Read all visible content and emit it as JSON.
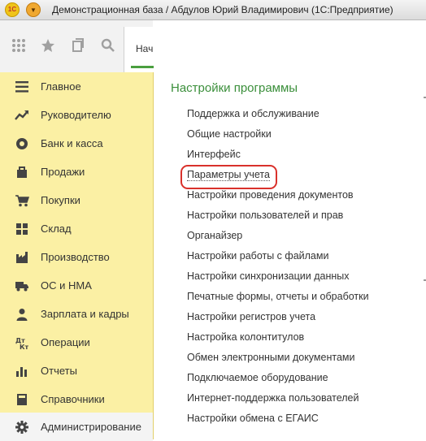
{
  "window": {
    "title": "Демонстрационная база / Абдулов Юрий Владимирович  (1С:Предприятие)",
    "logo_text": "1С"
  },
  "toolbar": {
    "icons": [
      "apps-grid-icon",
      "star-icon",
      "history-icon",
      "search-icon"
    ],
    "start_tab_label": "Нач"
  },
  "sidebar": {
    "active_index": 12,
    "items": [
      {
        "label": "Главное",
        "icon": "menu-lines-icon"
      },
      {
        "label": "Руководителю",
        "icon": "trend-icon"
      },
      {
        "label": "Банк и касса",
        "icon": "coins-icon"
      },
      {
        "label": "Продажи",
        "icon": "bag-icon"
      },
      {
        "label": "Покупки",
        "icon": "cart-icon"
      },
      {
        "label": "Склад",
        "icon": "warehouse-icon"
      },
      {
        "label": "Производство",
        "icon": "factory-icon"
      },
      {
        "label": "ОС и НМА",
        "icon": "truck-icon"
      },
      {
        "label": "Зарплата и кадры",
        "icon": "person-icon"
      },
      {
        "label": "Операции",
        "icon": "dt-kt-icon"
      },
      {
        "label": "Отчеты",
        "icon": "bar-chart-icon"
      },
      {
        "label": "Справочники",
        "icon": "book-icon"
      },
      {
        "label": "Администрирование",
        "icon": "gear-icon"
      }
    ]
  },
  "panel": {
    "title": "Настройки программы",
    "highlighted_index": 3,
    "links": [
      "Поддержка и обслуживание",
      "Общие настройки",
      "Интерфейс",
      "Параметры учета",
      "Настройки проведения документов",
      "Настройки пользователей и прав",
      "Органайзер",
      "Настройки работы с файлами",
      "Настройки синхронизации данных",
      "Печатные формы, отчеты и обработки",
      "Настройки регистров учета",
      "Настройка колонтитулов",
      "Обмен электронными документами",
      "Подключаемое оборудование",
      "Интернет-поддержка пользователей",
      "Настройки обмена с ЕГАИС"
    ]
  },
  "colors": {
    "sidebar_bg": "#fbf0a4",
    "panel_title": "#3b8f3b",
    "highlight": "#d9312b",
    "tab_accent": "#4a9f3f"
  }
}
